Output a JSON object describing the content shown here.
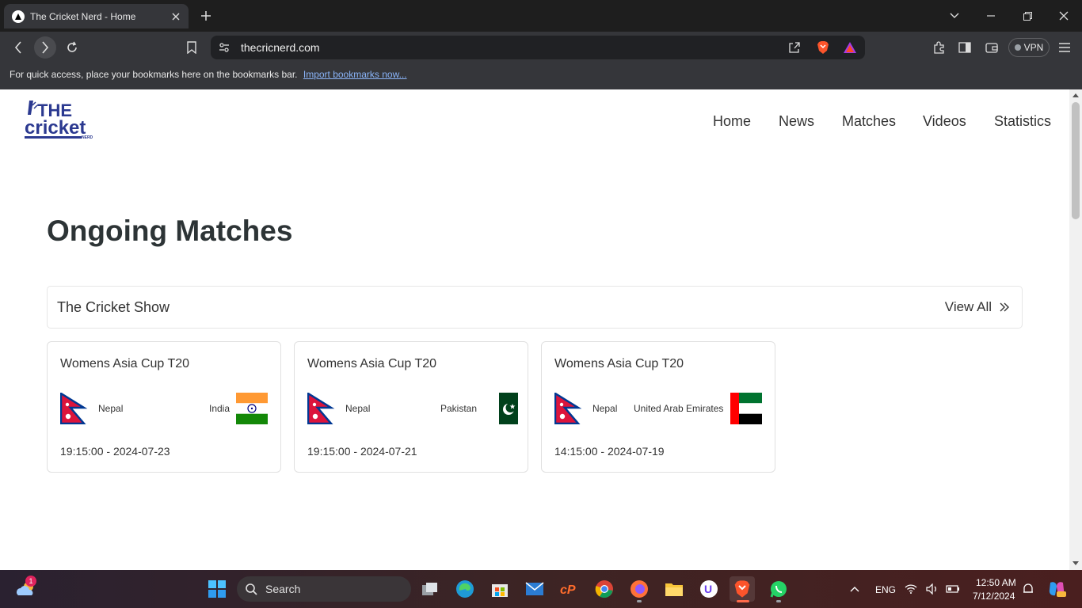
{
  "browser": {
    "tab_title": "The Cricket Nerd - Home",
    "url": "thecricnerd.com",
    "vpn_label": "VPN",
    "bookmarks_bar_text": "For quick access, place your bookmarks here on the bookmarks bar.",
    "bookmarks_bar_link": "Import bookmarks now..."
  },
  "site": {
    "logo_alt": "THE cricket NERD",
    "nav": [
      "Home",
      "News",
      "Matches",
      "Videos",
      "Statistics"
    ]
  },
  "main": {
    "heading": "Ongoing Matches",
    "panel_title": "The Cricket Show",
    "view_all": "View All"
  },
  "matches": [
    {
      "series": "Womens Asia Cup T20",
      "team1": "Nepal",
      "team2": "India",
      "time": "19:15:00 - 2024-07-23",
      "flag1": "nepal-flag",
      "flag2": "india-flag"
    },
    {
      "series": "Womens Asia Cup T20",
      "team1": "Nepal",
      "team2": "Pakistan",
      "time": "19:15:00 - 2024-07-21",
      "flag1": "nepal-flag",
      "flag2": "pakistan-flag"
    },
    {
      "series": "Womens Asia Cup T20",
      "team1": "Nepal",
      "team2": "United Arab Emirates",
      "time": "14:15:00 - 2024-07-19",
      "flag1": "nepal-flag",
      "flag2": "uae-flag"
    }
  ],
  "taskbar": {
    "search_placeholder": "Search",
    "weather_badge": "1",
    "language": "ENG",
    "time": "12:50 AM",
    "date": "7/12/2024"
  },
  "colors": {
    "brand_blue": "#2b3990",
    "browser_dark": "#35363a"
  }
}
